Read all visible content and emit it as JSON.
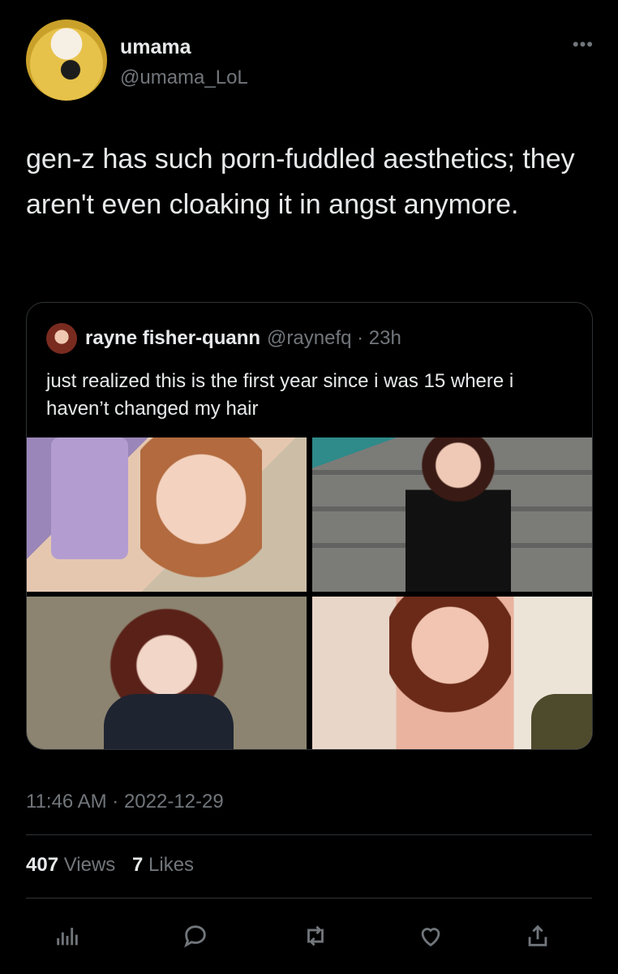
{
  "author": {
    "display_name": "umama",
    "handle": "@umama_LoL",
    "more_icon": "more-horizontal-icon"
  },
  "tweet": {
    "text": "gen-z has such porn-fuddled aesthetics; they aren't even cloaking it in angst anymore."
  },
  "quoted_tweet": {
    "display_name": "rayne fisher-quann",
    "handle_time": "@raynefq · 23h",
    "text": "just realized this is the first year since i was 15 where i haven’t changed my hair"
  },
  "timestamp": "11:46 AM · 2022-12-29",
  "stats": {
    "views_count": "407",
    "views_label": "Views",
    "likes_count": "7",
    "likes_label": "Likes"
  },
  "actions": [
    "analytics-icon",
    "reply-icon",
    "retweet-icon",
    "like-icon",
    "share-icon"
  ],
  "colors": {
    "background": "#000000",
    "text_primary": "#e7e9ea",
    "text_secondary": "#71767b",
    "border": "#2f3336"
  }
}
